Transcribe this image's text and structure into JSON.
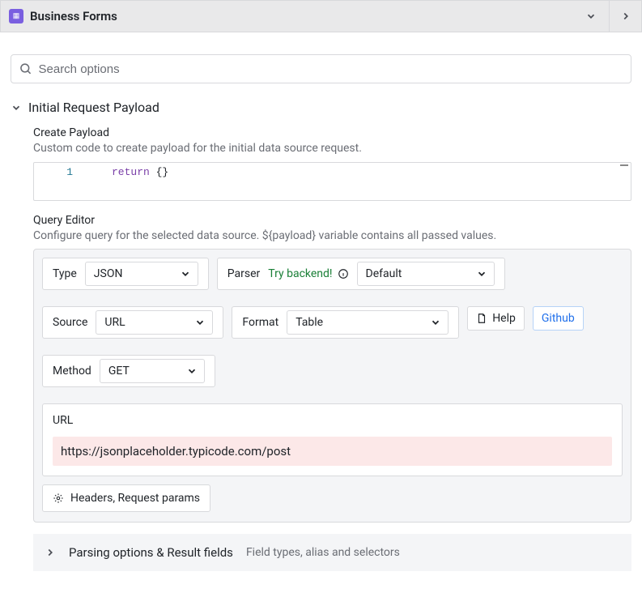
{
  "header": {
    "title": "Business Forms"
  },
  "search": {
    "placeholder": "Search options"
  },
  "section": {
    "title": "Initial Request Payload"
  },
  "createPayload": {
    "title": "Create Payload",
    "desc": "Custom code to create payload for the initial data source request.",
    "lineNumber": "1",
    "codeKeyword": "return",
    "codeRest": " {}"
  },
  "queryEditor": {
    "title": "Query Editor",
    "desc": "Configure query for the selected data source. ${payload} variable contains all passed values.",
    "type": {
      "label": "Type",
      "value": "JSON"
    },
    "parser": {
      "label": "Parser",
      "hint": "Try backend!",
      "value": "Default"
    },
    "source": {
      "label": "Source",
      "value": "URL"
    },
    "format": {
      "label": "Format",
      "value": "Table"
    },
    "helpBtn": "Help",
    "githubBtn": "Github",
    "method": {
      "label": "Method",
      "value": "GET"
    },
    "url": {
      "label": "URL",
      "value": "https://jsonplaceholder.typicode.com/post"
    },
    "headersBtn": "Headers, Request params"
  },
  "parsing": {
    "title": "Parsing options & Result fields",
    "desc": "Field types, alias and selectors"
  }
}
